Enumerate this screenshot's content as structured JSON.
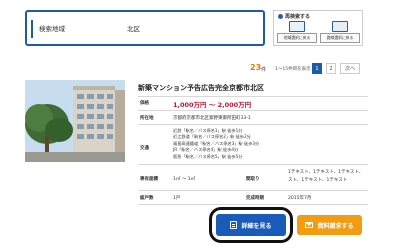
{
  "search": {
    "area_label": "検索地域",
    "area_value": "北区"
  },
  "rechoose": {
    "title": "再検索する",
    "by_area": "地域選択に戻る",
    "by_route": "路線選択に戻る"
  },
  "pager": {
    "count": "23",
    "count_unit": "件",
    "range": "1〜15件目を表示",
    "pages": [
      "1",
      "2"
    ],
    "current_page": "1",
    "next_label": "次へ"
  },
  "property": {
    "title": "新築マンション予告広告完全京都市北区",
    "price_label": "価格",
    "price_value": "1,000万円 ～ 2,000万円",
    "address_label": "所在地",
    "address_value": "京都府京都市北区紫野東御所田町33-1",
    "access_label": "交通",
    "access_lines": [
      "近鉄「駅名／バス停名1」駅 徒歩1分",
      "近江鉄道「駅名／バス停名2」駅 徒歩2分",
      "福島高速鐵道「駅名／バス停名3」駅 徒歩3分",
      "JR「駅名／バス停名4」駅 徒歩4分",
      "阪急「駅名／バス停名5」駅 徒歩5分"
    ],
    "area_label": "専有面積",
    "area_value": "1㎡ ～ 1㎡",
    "layout_label": "間取り",
    "layout_value_1": "1テキスト、1テキスト、1テキスト、",
    "layout_value_2": "スト、1テキスト、1テキスト",
    "units_label": "総戸数",
    "units_value": "1戸",
    "completion_label": "完成時期",
    "completion_value": "2015年7月"
  },
  "actions": {
    "detail": "詳細を見る",
    "request": "資料請求する"
  },
  "colors": {
    "brand_blue": "#1e5aa8",
    "price_red": "#c8102e",
    "count_orange": "#e07b00",
    "request_orange": "#f39c12"
  }
}
